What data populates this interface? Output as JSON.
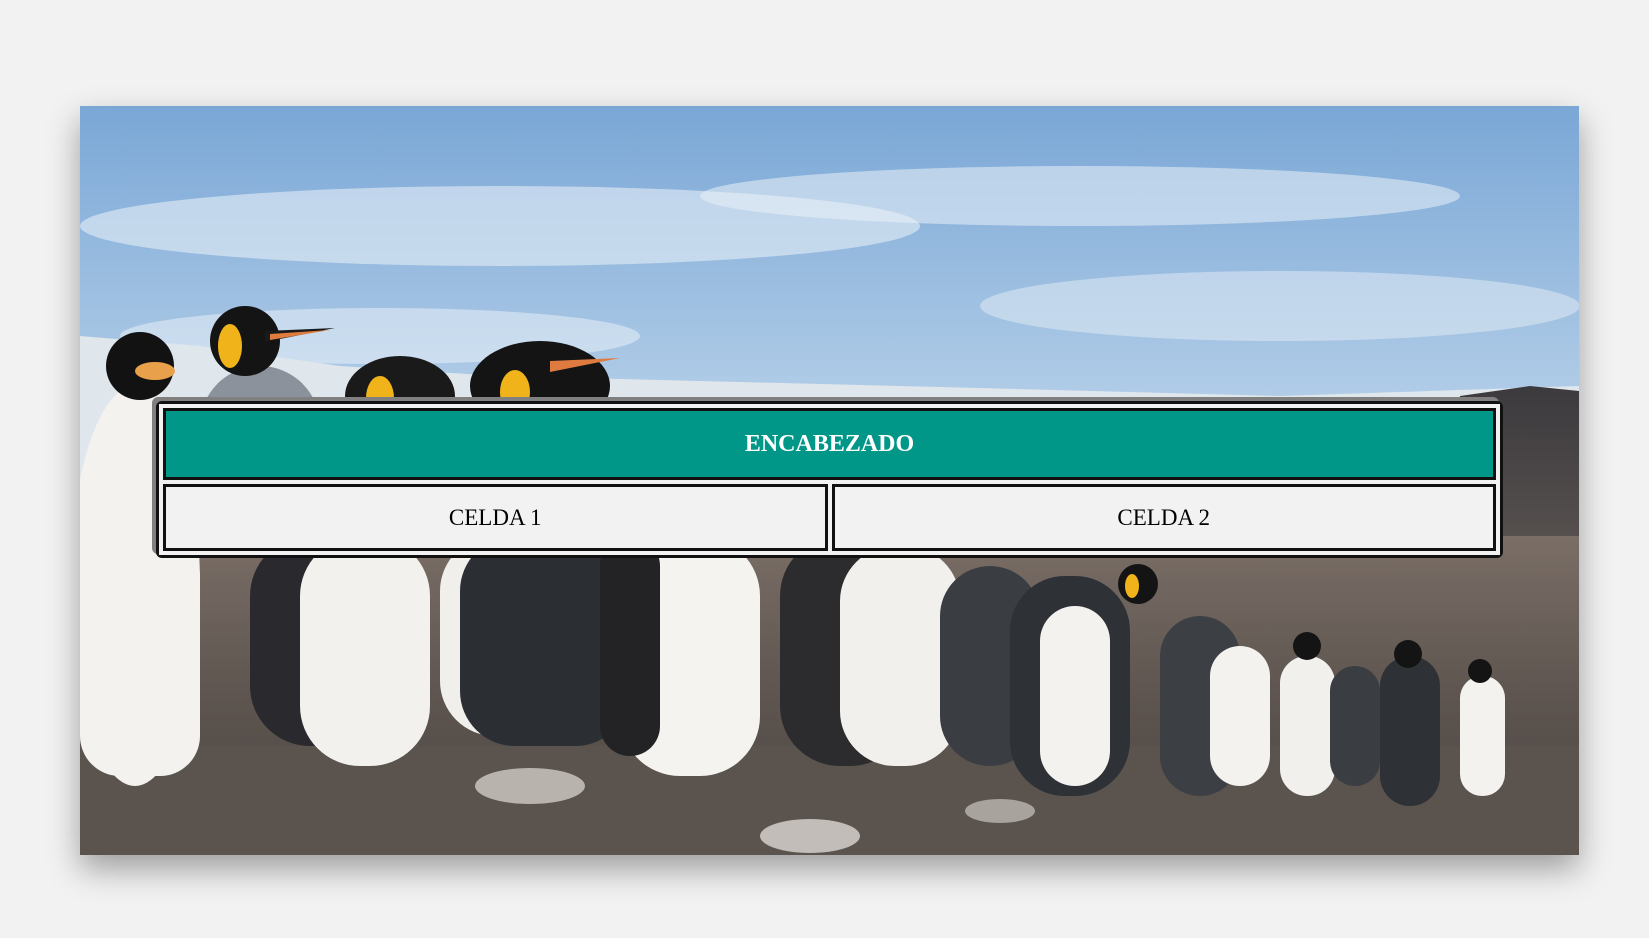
{
  "table": {
    "header": "ENCABEZADO",
    "cells": [
      "CELDA 1",
      "CELDA 2"
    ]
  },
  "colors": {
    "header_bg": "#009688",
    "page_bg": "#f2f2f2"
  }
}
